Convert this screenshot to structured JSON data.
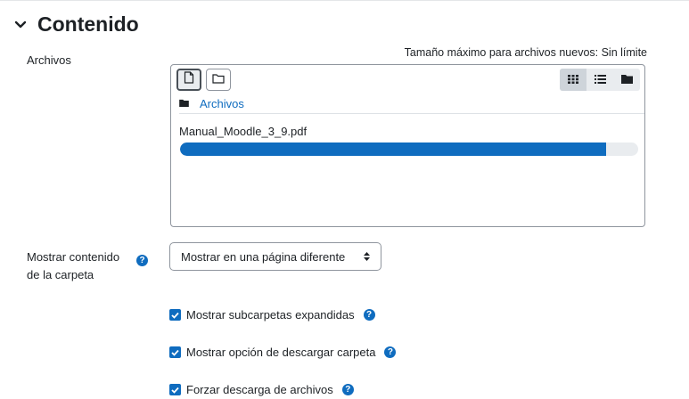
{
  "section": {
    "title": "Contenido"
  },
  "files": {
    "label": "Archivos",
    "max_size": "Tamaño máximo para archivos nuevos: Sin límite",
    "path_label": "Archivos",
    "uploading_file": "Manual_Moodle_3_9.pdf",
    "upload_progress_percent": 93
  },
  "display": {
    "label_line1": "Mostrar contenido",
    "label_line2": "de la carpeta",
    "selected_option": "Mostrar en una página diferente"
  },
  "options": [
    {
      "label": "Mostrar subcarpetas expandidas",
      "checked": true
    },
    {
      "label": "Mostrar opción de descargar carpeta",
      "checked": true
    },
    {
      "label": "Forzar descarga de archivos",
      "checked": true
    }
  ],
  "colors": {
    "primary": "#0f6cbf",
    "text": "#1d2125",
    "border": "#8f959e"
  },
  "icons": {
    "section": "chevron-down-icon",
    "help": "question-circle-icon",
    "add_file": "file-icon",
    "create_folder": "folder-icon",
    "view_icons": "grid-icon",
    "view_list": "list-icon",
    "view_tree": "folder-solid-icon"
  }
}
